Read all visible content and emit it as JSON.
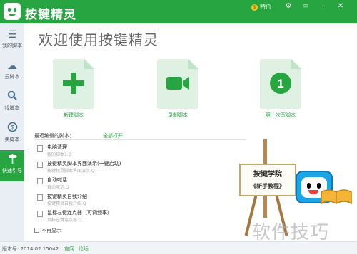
{
  "titlebar": {
    "app_title": "按键精灵",
    "feature_badge": "特价",
    "icons": [
      "settings-icon",
      "menu-icon",
      "minimize-icon",
      "close-icon"
    ]
  },
  "sidebar": {
    "items": [
      {
        "label": "我的脚本",
        "icon": "list-icon"
      },
      {
        "label": "云脚本",
        "icon": "cloud-icon"
      },
      {
        "label": "找脚本",
        "icon": "search-icon"
      },
      {
        "label": "卖脚本",
        "icon": "dollar-icon"
      },
      {
        "label": "快速引导",
        "icon": "signpost-icon",
        "active": true
      }
    ]
  },
  "main": {
    "heading": "欢迎使用按键精灵",
    "cards": [
      {
        "label": "新建脚本",
        "icon": "plus-icon"
      },
      {
        "label": "录制脚本",
        "icon": "video-camera-icon"
      },
      {
        "label": "第一次写脚本",
        "icon": "number-one-icon",
        "number": "1"
      }
    ],
    "recent": {
      "header": "最近编辑的脚本：",
      "open_all": "全部打开",
      "items": [
        {
          "title": "电脑清理",
          "subtitle": "我的脚本1.Q"
        },
        {
          "title": "按键精灵脚本界面演示(一键启动)",
          "subtitle": "按键精灵脚本界面演示.Q"
        },
        {
          "title": "自动喊话",
          "subtitle": "自动喊话.Q"
        },
        {
          "title": "按键精灵自我介绍",
          "subtitle": "按键精灵自我介绍.Q"
        },
        {
          "title": "鼠标左键连点器（可调频率）",
          "subtitle": "鼠标左键连点器.Q"
        }
      ]
    },
    "no_show_again": "不再显示"
  },
  "promo": {
    "board_title": "按键学院",
    "board_subtitle": "《新手教程》"
  },
  "statusbar": {
    "version": "版本号: 2014.02.15042",
    "link_website": "官网",
    "link_forum": "论坛"
  },
  "watermark": "软件技巧",
  "colors": {
    "accent": "#27a541",
    "sidebar_bg": "#e8eef3"
  }
}
